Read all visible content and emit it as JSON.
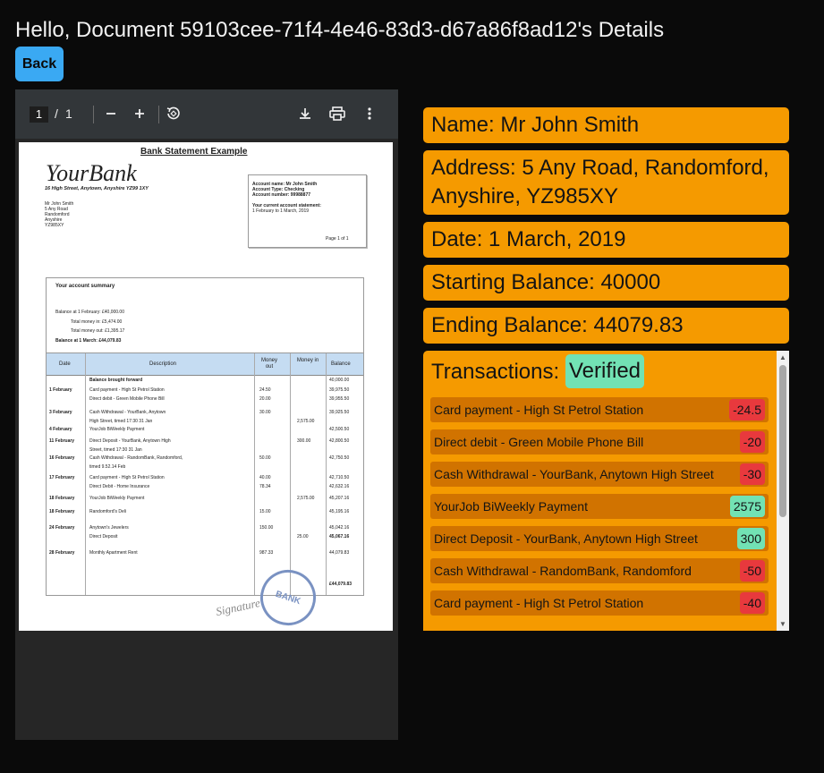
{
  "header": {
    "title": "Hello, Document 59103cee-71f4-4e46-83d3-d67a86f8ad12's Details",
    "back_label": "Back"
  },
  "pdf_viewer": {
    "current_page": "1",
    "separator": "/",
    "total_pages": "1",
    "page": {
      "title": "Bank Statement Example",
      "bank_logo": "YourBank",
      "bank_address": "16 High Street, Anytown, Anyshire YZ99 1XY",
      "customer_lines": [
        "Mr John Smith",
        "5 Any Road",
        "Randomford",
        "Anyshire",
        "YZ985XY"
      ],
      "account_box": [
        "Account name: Mr John Smith",
        "Account Type: Checking",
        "Account number: 99988877",
        "",
        "Your current account statement:",
        "1  February  to 1 March, 2019"
      ],
      "page_of": "Page 1 of 1",
      "summary_title": "Your account summary",
      "summary_lines": [
        "Balance at 1 February:  £40,000.00",
        "Total money in:   £5,474.00",
        "Total money out:  £1,395.17",
        "Balance at 1 March:   £44,079.83"
      ],
      "table_headers": [
        "Date",
        "Description",
        "Money out",
        "Money in",
        "Balance"
      ],
      "table_rows": [
        {
          "date": "",
          "desc": "Balance brought forward",
          "out": "",
          "in": "",
          "bal": "40,000.00"
        },
        {
          "date": "1 February",
          "desc": "Card payment - High St Petrol Station",
          "out": "24.50",
          "in": "",
          "bal": "39,975.50"
        },
        {
          "date": "",
          "desc": "Direct debit - Green Mobile Phone Bill",
          "out": "20.00",
          "in": "",
          "bal": "39,955.50"
        },
        {
          "date": "3 February",
          "desc": "Cash Withdrawal - YourBank, Anytown",
          "out": "30.00",
          "in": "",
          "bal": "39,925.50"
        },
        {
          "date": "",
          "desc": "High Street, timed 17:30 31 Jan",
          "out": "",
          "in": "2,575.00",
          "bal": ""
        },
        {
          "date": "4 February",
          "desc": "YourJob BiWeekly Payment",
          "out": "",
          "in": "",
          "bal": "42,500.50"
        },
        {
          "date": "11 February",
          "desc": "Direct Deposit - YourBank, Anytown High",
          "out": "",
          "in": "300.00",
          "bal": "42,800.50"
        },
        {
          "date": "",
          "desc": "Street, timed 17:30 31 Jan",
          "out": "",
          "in": "",
          "bal": ""
        },
        {
          "date": "16 February",
          "desc": "Cash Withdrawal - RandomBank, Randomford,",
          "out": "50.00",
          "in": "",
          "bal": "42,750.50"
        },
        {
          "date": "",
          "desc": "timed 9.52.14 Feb",
          "out": "",
          "in": "",
          "bal": ""
        },
        {
          "date": "17 February",
          "desc": "Card payment - High St Petrol Station",
          "out": "40.00",
          "in": "",
          "bal": "42,710.50"
        },
        {
          "date": "",
          "desc": "Direct Debit - Home Insurance",
          "out": "78.34",
          "in": "",
          "bal": "42,632.16"
        },
        {
          "date": "18 February",
          "desc": "YourJob BiWeekly Payment",
          "out": "",
          "in": "2,575.00",
          "bal": "45,207.16"
        },
        {
          "date": "18 February",
          "desc": "Randomford's Deli",
          "out": "15.00",
          "in": "",
          "bal": "45,195.16"
        },
        {
          "date": "24 February",
          "desc": "Anytown's Jewelers",
          "out": "150.00",
          "in": "",
          "bal": "45,042.16"
        },
        {
          "date": "",
          "desc": "Direct Deposit",
          "out": "",
          "in": "25.00",
          "bal": "45,067.16"
        },
        {
          "date": "28 February",
          "desc": "Monthly Apartment Rent",
          "out": "987.33",
          "in": "",
          "bal": "44,079.83"
        },
        {
          "date": "",
          "desc": "",
          "out": "",
          "in": "",
          "bal": "£44,079.83"
        }
      ],
      "stamp_text": "BANK",
      "signature_text": "Signature"
    }
  },
  "details": {
    "name": "Name: Mr John Smith",
    "address": "Address: 5 Any Road, Randomford, Anyshire, YZ985XY",
    "date": "Date: 1 March, 2019",
    "starting_balance": "Starting Balance: 40000",
    "ending_balance": "Ending Balance: 44079.83"
  },
  "transactions": {
    "title": "Transactions:",
    "status": "Verified",
    "items": [
      {
        "description": "Card payment - High St Petrol Station",
        "amount": "-24.5",
        "kind": "neg"
      },
      {
        "description": "Direct debit - Green Mobile Phone Bill",
        "amount": "-20",
        "kind": "neg"
      },
      {
        "description": "Cash Withdrawal - YourBank, Anytown High Street",
        "amount": "-30",
        "kind": "neg"
      },
      {
        "description": "YourJob BiWeekly Payment",
        "amount": "2575",
        "kind": "pos"
      },
      {
        "description": "Direct Deposit - YourBank, Anytown High Street",
        "amount": "300",
        "kind": "pos"
      },
      {
        "description": "Cash Withdrawal - RandomBank, Randomford",
        "amount": "-50",
        "kind": "neg"
      },
      {
        "description": "Card payment - High St Petrol Station",
        "amount": "-40",
        "kind": "neg"
      }
    ]
  },
  "colors": {
    "card_bg": "#f59a00",
    "row_bg": "#d17300",
    "negative": "#e8393d",
    "positive": "#72e2b4",
    "back_button": "#3aa9f3"
  }
}
